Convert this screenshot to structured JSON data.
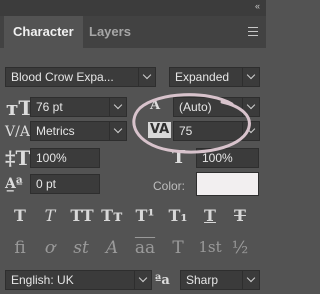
{
  "panel": {
    "tabs": [
      "Character",
      "Layers"
    ],
    "collapse_glyph": "«"
  },
  "font": {
    "family": "Blood Crow Expa...",
    "style": "Expanded"
  },
  "size": {
    "font_size": "76 pt",
    "leading": "(Auto)"
  },
  "kerning": {
    "value": "Metrics",
    "tracking": "75"
  },
  "scale": {
    "vertical": "100%",
    "horizontal": "100%"
  },
  "baseline": {
    "shift": "0 pt",
    "color_label": "Color:"
  },
  "style_buttons": [
    "T",
    "T",
    "TT",
    "Tт",
    "T¹",
    "T₁",
    "T",
    "T"
  ],
  "opentype_buttons": [
    "fi",
    "ơ",
    "st",
    "A",
    "aa",
    "T",
    "1st",
    "½"
  ],
  "language": {
    "value": "English: UK",
    "aa_icon": "ªa",
    "antialias": "Sharp"
  },
  "colors": {
    "annotation": "#d8c3cc",
    "swatch": "#f2eff0"
  }
}
